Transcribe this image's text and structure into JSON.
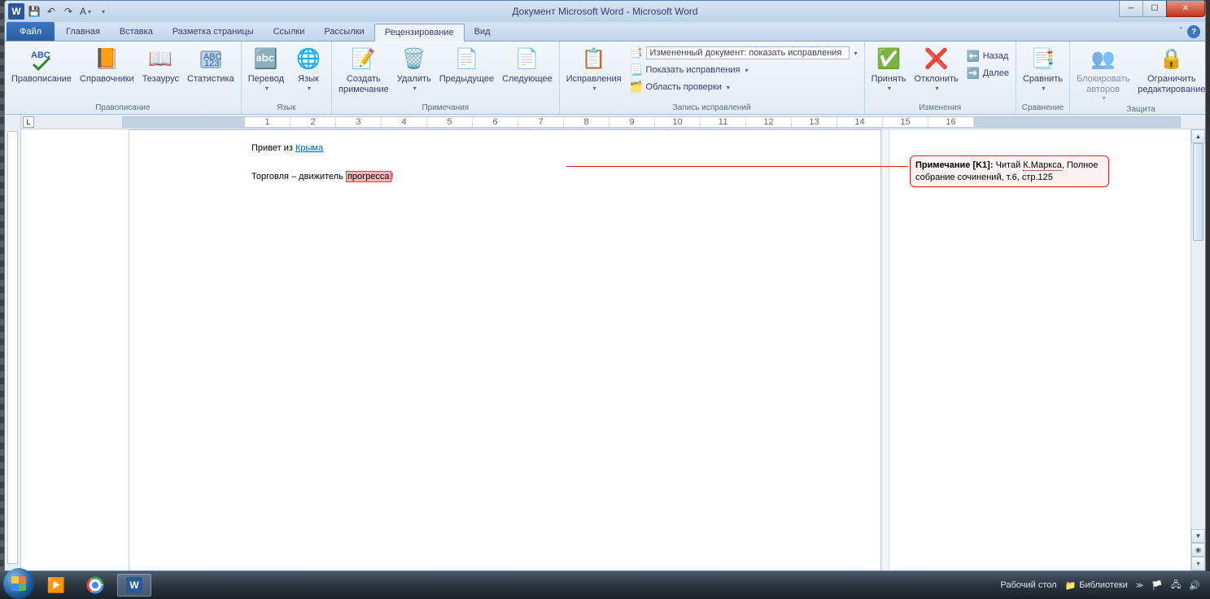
{
  "title": "Документ Microsoft Word  -  Microsoft Word",
  "tabs": {
    "file": "Файл",
    "items": [
      "Главная",
      "Вставка",
      "Разметка страницы",
      "Ссылки",
      "Рассылки",
      "Рецензирование",
      "Вид"
    ],
    "activeIndex": 5
  },
  "ribbon": {
    "proofing": {
      "label": "Правописание",
      "spelling": "Правописание",
      "research": "Справочники",
      "thesaurus": "Тезаурус",
      "wordcount": "Статистика"
    },
    "language": {
      "label": "Язык",
      "translate": "Перевод",
      "language": "Язык"
    },
    "comments": {
      "label": "Примечания",
      "new": "Создать\nпримечание",
      "delete": "Удалить",
      "previous": "Предыдущее",
      "next": "Следующее"
    },
    "tracking": {
      "label": "Запись исправлений",
      "track": "Исправления",
      "display": "Измененный документ: показать исправления",
      "showmarkup": "Показать исправления",
      "reviewpane": "Область проверки"
    },
    "changes": {
      "label": "Изменения",
      "accept": "Принять",
      "reject": "Отклонить",
      "back": "Назад",
      "forward": "Далее"
    },
    "compare": {
      "label": "Сравнение",
      "compare": "Сравнить"
    },
    "protect": {
      "label": "Защита",
      "block": "Блокировать\nавторов",
      "restrict": "Ограничить\nредактирование"
    }
  },
  "doc": {
    "line1a": "Привет из ",
    "line1link": "Крыма",
    "line2a": "Торговля – движитель ",
    "line2hl": "прогресса",
    "line2b": "!"
  },
  "comment": {
    "label": "Примечание [K1]: ",
    "text1": "Читай ",
    "dotted": "К.Маркса",
    "text2": ", Полное собрание сочинений, т.6, стр.125"
  },
  "taskbar": {
    "desktop": "Рабочий стол",
    "libs": "Библиотеки"
  }
}
